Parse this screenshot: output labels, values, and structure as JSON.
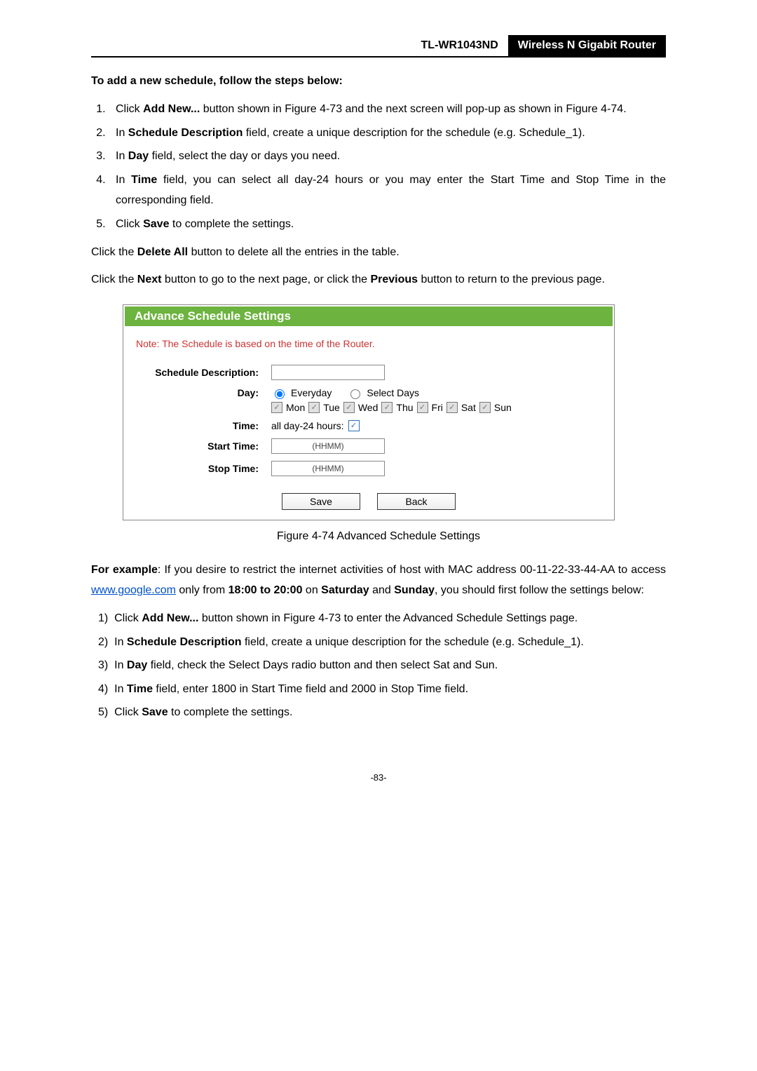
{
  "header": {
    "model": "TL-WR1043ND",
    "product": "Wireless N Gigabit Router"
  },
  "heading1": "To add a new schedule, follow the steps below:",
  "steps": [
    {
      "pre": "Click ",
      "bold1": "Add New...",
      "post": " button shown in Figure 4-73 and the next screen will pop-up as shown in Figure 4-74."
    },
    {
      "pre": "In ",
      "bold1": "Schedule Description",
      "post": " field, create a unique description for the schedule (e.g. Schedule_1)."
    },
    {
      "pre": "In ",
      "bold1": "Day",
      "post": " field, select the day or days you need."
    },
    {
      "pre": "In ",
      "bold1": "Time",
      "post": " field, you can select all day-24 hours or you may enter the Start Time and Stop Time in the corresponding field."
    },
    {
      "pre": "Click ",
      "bold1": "Save",
      "post": " to complete the settings."
    }
  ],
  "deleteAll": {
    "pre": "Click the ",
    "bold": "Delete All",
    "post": " button to delete all the entries in the table."
  },
  "nextPrev": {
    "pre": "Click the ",
    "b1": "Next",
    "mid": " button to go to the next page, or click the ",
    "b2": "Previous",
    "post": " button to return to the previous page."
  },
  "figure": {
    "title": "Advance Schedule Settings",
    "note": "Note: The Schedule is based on the time of the Router.",
    "labels": {
      "desc": "Schedule Description:",
      "day": "Day:",
      "time": "Time:",
      "start": "Start Time:",
      "stop": "Stop Time:"
    },
    "day": {
      "everyday": "Everyday",
      "selectDays": "Select Days"
    },
    "days": [
      "Mon",
      "Tue",
      "Wed",
      "Thu",
      "Fri",
      "Sat",
      "Sun"
    ],
    "timeLabel": "all day-24 hours:",
    "hhmm": "(HHMM)",
    "buttons": {
      "save": "Save",
      "back": "Back"
    }
  },
  "caption": "Figure 4-74   Advanced Schedule Settings",
  "example": {
    "b1": "For example",
    "t1": ": If you desire to restrict the internet activities of host with MAC address 00-11-22-33-44-AA to access ",
    "link": "www.google.com",
    "t2": " only from ",
    "b2": "18:00 to 20:00",
    "t3": " on ",
    "b3": "Saturday",
    "t4": " and ",
    "b4": "Sunday",
    "t5": ", you should first follow the settings below:"
  },
  "exSteps": [
    {
      "pre": "Click ",
      "b": "Add New...",
      "post": " button shown in Figure 4-73 to enter the Advanced Schedule Settings page."
    },
    {
      "pre": "In ",
      "b": "Schedule Description",
      "post": " field, create a unique description for the schedule (e.g. Schedule_1)."
    },
    {
      "pre": "In ",
      "b": "Day",
      "post": " field, check the Select Days radio button and then select Sat and Sun."
    },
    {
      "pre": "In ",
      "b": "Time",
      "post": " field, enter 1800 in Start Time field and 2000 in Stop Time field."
    },
    {
      "pre": "Click ",
      "b": "Save",
      "post": " to complete the settings."
    }
  ],
  "pageNum": "-83-"
}
